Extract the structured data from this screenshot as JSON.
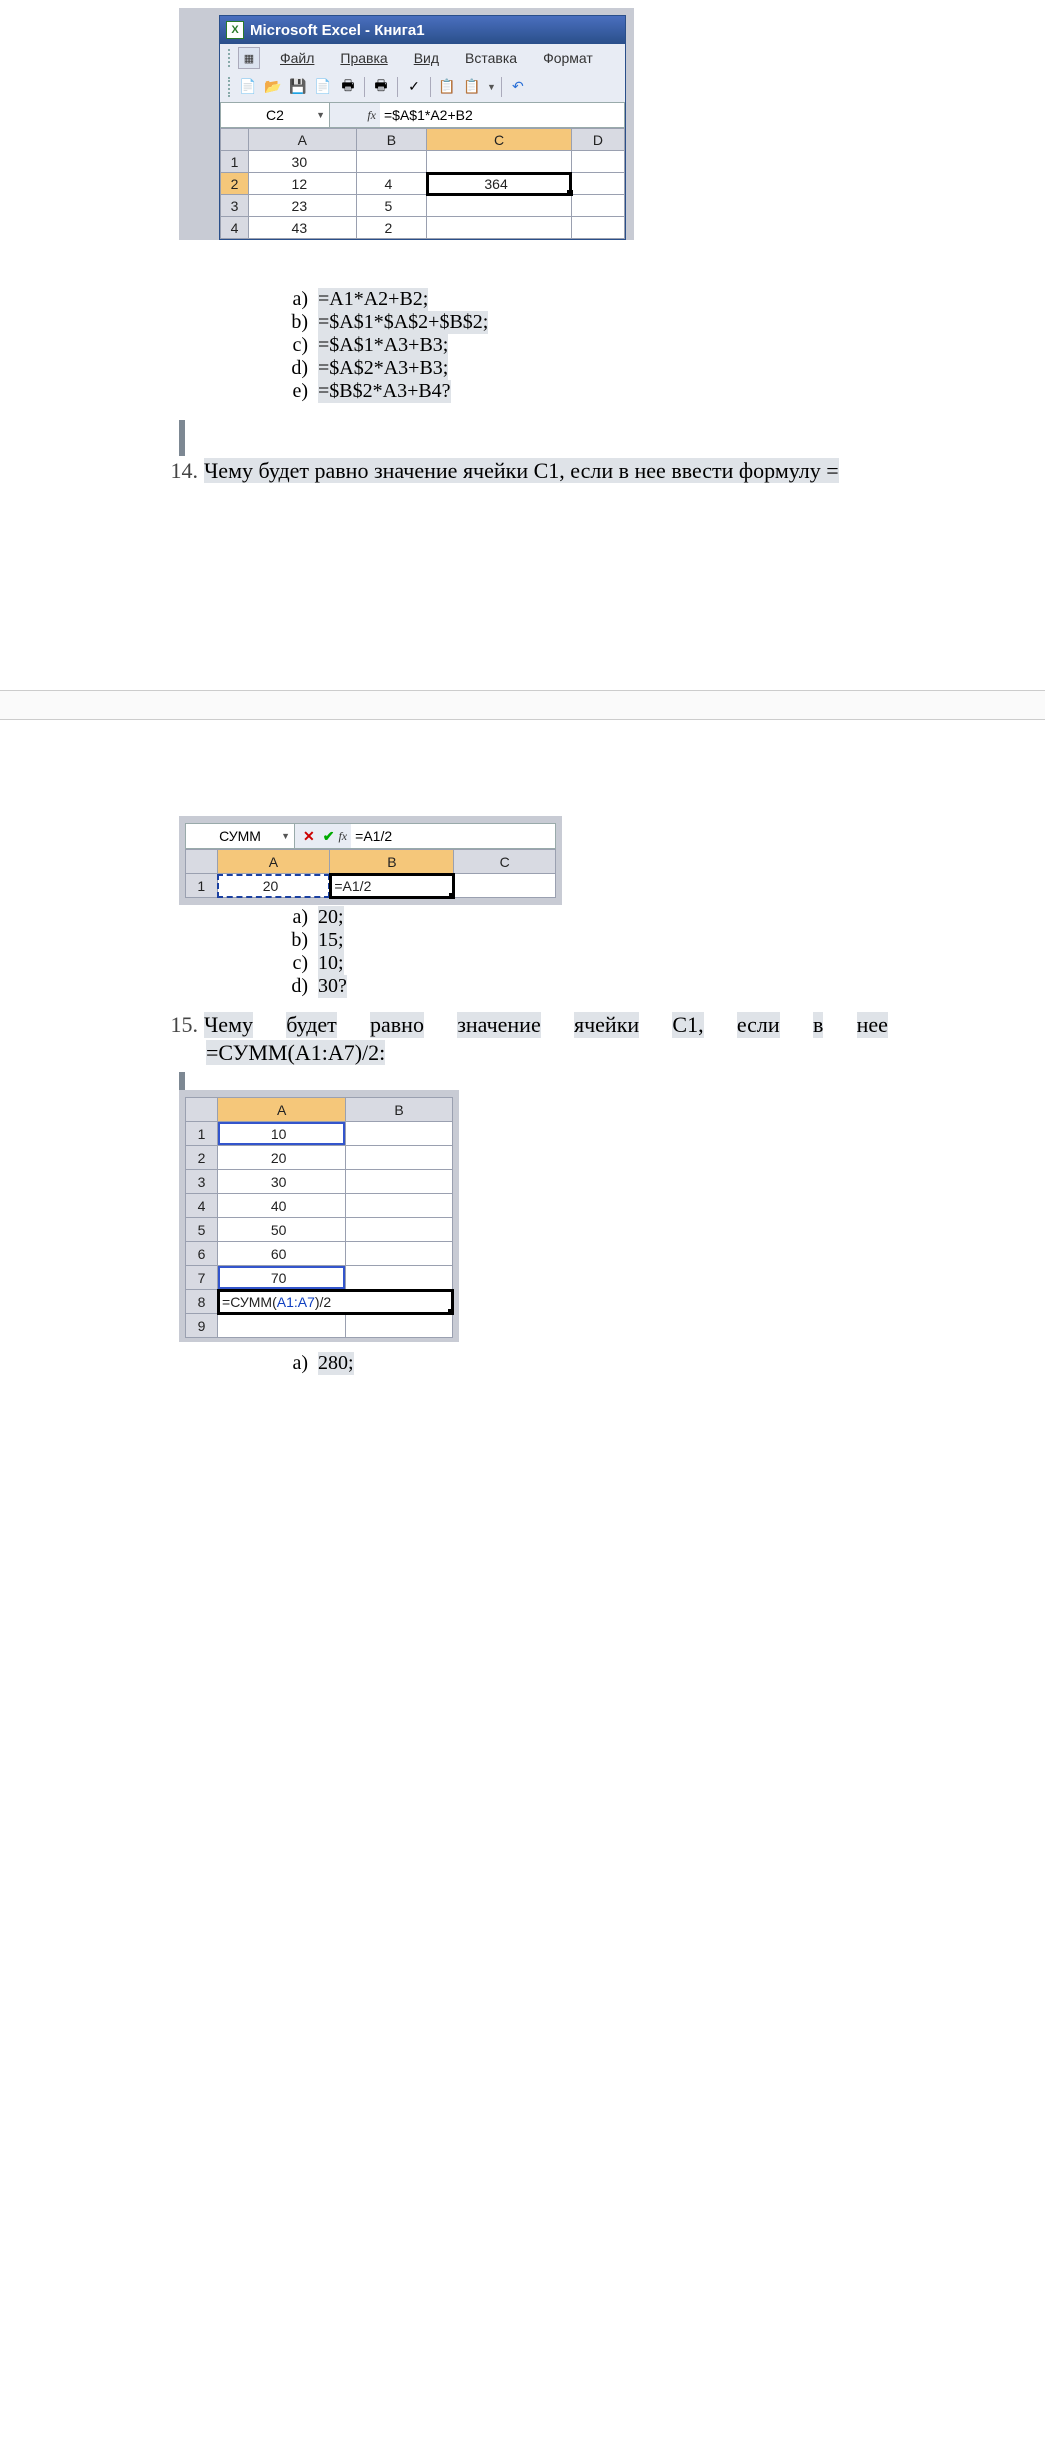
{
  "excel1": {
    "title": "Microsoft Excel - Книга1",
    "menu": {
      "file": "Файл",
      "edit": "Правка",
      "view": "Вид",
      "insert": "Вставка",
      "format": "Формат"
    },
    "namebox": "C2",
    "fx": "fx",
    "formula": "=$A$1*A2+B2",
    "columns": [
      "A",
      "B",
      "C",
      "D"
    ],
    "rows": [
      {
        "r": "1",
        "A": "30",
        "B": "",
        "C": "",
        "D": ""
      },
      {
        "r": "2",
        "A": "12",
        "B": "4",
        "C": "364",
        "D": ""
      },
      {
        "r": "3",
        "A": "23",
        "B": "5",
        "C": "",
        "D": ""
      },
      {
        "r": "4",
        "A": "43",
        "B": "2",
        "C": "",
        "D": ""
      }
    ]
  },
  "answers13": {
    "a": {
      "lbl": "a)",
      "txt": "=A1*A2+B2;"
    },
    "b": {
      "lbl": "b)",
      "txt": "=$A$1*$A$2+$B$2;"
    },
    "c": {
      "lbl": "c)",
      "txt": "=$A$1*A3+B3;"
    },
    "d": {
      "lbl": "d)",
      "txt": "=$A$2*A3+B3;"
    },
    "e": {
      "lbl": "e)",
      "txt": "=$B$2*A3+B4?"
    }
  },
  "q14": {
    "num": "14.",
    "text": "Чему будет равно значение ячейки С1, если в нее ввести формулу ="
  },
  "excel2": {
    "namebox": "СУММ",
    "fx": "fx",
    "formula": "=A1/2",
    "columns": [
      "A",
      "B",
      "C"
    ],
    "row1_hdr": "1",
    "A1": "20",
    "B1": "=A1/2"
  },
  "answers14": {
    "a": {
      "lbl": "a)",
      "txt": "20;"
    },
    "b": {
      "lbl": "b)",
      "txt": "15;"
    },
    "c": {
      "lbl": "c)",
      "txt": "10;"
    },
    "d": {
      "lbl": "d)",
      "txt": "30?"
    }
  },
  "q15": {
    "num": "15.",
    "line1_words": [
      "Чему",
      "будет",
      "равно",
      "значение",
      "ячейки",
      "С1,",
      "если",
      "в",
      "нее"
    ],
    "line2": "=СУММ(А1:А7)/2:"
  },
  "excel3": {
    "columns": [
      "A",
      "B"
    ],
    "rows": [
      {
        "r": "1",
        "A": "10"
      },
      {
        "r": "2",
        "A": "20"
      },
      {
        "r": "3",
        "A": "30"
      },
      {
        "r": "4",
        "A": "40"
      },
      {
        "r": "5",
        "A": "50"
      },
      {
        "r": "6",
        "A": "60"
      },
      {
        "r": "7",
        "A": "70"
      }
    ],
    "row8_hdr": "8",
    "row8_prefix": "=СУММ(",
    "row8_ref": "A1:A7",
    "row8_suffix": ")/2",
    "row9_hdr": "9"
  },
  "answers15": {
    "a": {
      "lbl": "a)",
      "txt": "280;"
    }
  }
}
